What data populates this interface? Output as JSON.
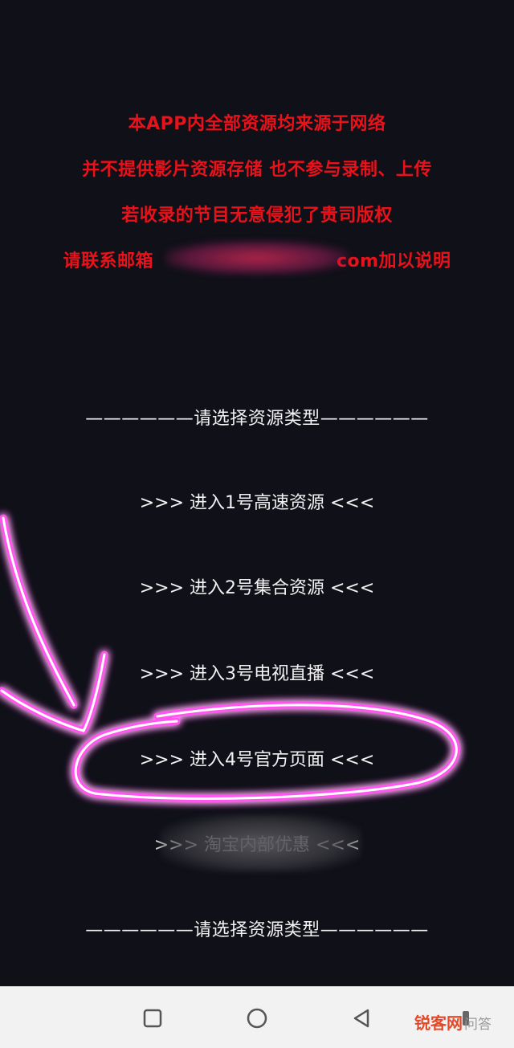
{
  "disclaimer": {
    "line1": "本APP内全部资源均来源于网络",
    "line2": "并不提供影片资源存储 也不参与录制、上传",
    "line3": "若收录的节目无意侵犯了贵司版权",
    "line4_prefix": "请联系邮箱",
    "line4_suffix": "com加以说明",
    "color": "#e8121a"
  },
  "menu": {
    "header": "——————请选择资源类型——————",
    "items": [
      {
        "label": ">>> 进入1号高速资源 <<<"
      },
      {
        "label": ">>> 进入2号集合资源 <<<"
      },
      {
        "label": ">>> 进入3号电视直播 <<<"
      },
      {
        "label": ">>> 进入4号官方页面 <<<"
      },
      {
        "label": ">>> 淘宝内部优惠 <<<"
      }
    ],
    "footer": "——————请选择资源类型——————"
  },
  "annotation": {
    "color": "#ff4df0",
    "target": ">>> 进入4号官方页面 <<<"
  },
  "navbar": {
    "icons": [
      "square-recents-icon",
      "circle-home-icon",
      "triangle-back-icon"
    ]
  },
  "watermark": {
    "brand": "锐客网",
    "suffix": "问答"
  }
}
